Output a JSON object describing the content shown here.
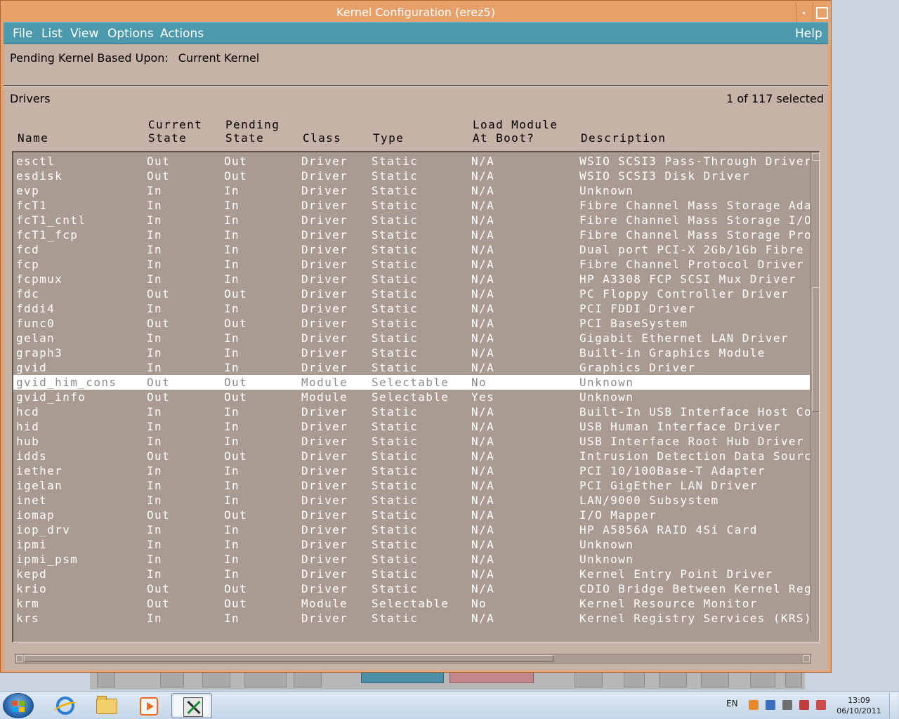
{
  "window": {
    "title": "Kernel Configuration (erez5)"
  },
  "menu": {
    "file": "File",
    "list": "List",
    "view": "View",
    "options": "Options",
    "actions": "Actions",
    "help": "Help"
  },
  "pending": {
    "label": "Pending Kernel Based Upon:",
    "value": "Current Kernel"
  },
  "list": {
    "title": "Drivers",
    "selection": "1 of 117 selected"
  },
  "columns": {
    "name": "Name",
    "current": "Current\nState",
    "pending": "Pending\nState",
    "class": "Class",
    "type": "Type",
    "load": "Load Module\nAt Boot?",
    "description": "Description"
  },
  "rows": [
    [
      "esctl",
      "Out",
      "Out",
      "Driver",
      "Static",
      "N/A",
      "WSIO SCSI3 Pass-Through Driver"
    ],
    [
      "esdisk",
      "Out",
      "Out",
      "Driver",
      "Static",
      "N/A",
      "WSIO SCSI3 Disk Driver"
    ],
    [
      "evp",
      "In",
      "In",
      "Driver",
      "Static",
      "N/A",
      "Unknown"
    ],
    [
      "fcT1",
      "In",
      "In",
      "Driver",
      "Static",
      "N/A",
      "Fibre Channel Mass Storage Ada"
    ],
    [
      "fcT1_cntl",
      "In",
      "In",
      "Driver",
      "Static",
      "N/A",
      "Fibre Channel Mass Storage I/O"
    ],
    [
      "fcT1_fcp",
      "In",
      "In",
      "Driver",
      "Static",
      "N/A",
      "Fibre Channel Mass Storage Pro"
    ],
    [
      "fcd",
      "In",
      "In",
      "Driver",
      "Static",
      "N/A",
      "Dual port PCI-X 2Gb/1Gb Fibre"
    ],
    [
      "fcp",
      "In",
      "In",
      "Driver",
      "Static",
      "N/A",
      "Fibre Channel Protocol Driver"
    ],
    [
      "fcpmux",
      "In",
      "In",
      "Driver",
      "Static",
      "N/A",
      "HP A3308 FCP SCSI Mux Driver"
    ],
    [
      "fdc",
      "Out",
      "Out",
      "Driver",
      "Static",
      "N/A",
      "PC Floppy Controller Driver"
    ],
    [
      "fddi4",
      "In",
      "In",
      "Driver",
      "Static",
      "N/A",
      "PCI FDDI Driver"
    ],
    [
      "func0",
      "Out",
      "Out",
      "Driver",
      "Static",
      "N/A",
      "PCI BaseSystem"
    ],
    [
      "gelan",
      "In",
      "In",
      "Driver",
      "Static",
      "N/A",
      "Gigabit Ethernet LAN Driver"
    ],
    [
      "graph3",
      "In",
      "In",
      "Driver",
      "Static",
      "N/A",
      "Built-in Graphics Module"
    ],
    [
      "gvid",
      "In",
      "In",
      "Driver",
      "Static",
      "N/A",
      "Graphics Driver"
    ],
    [
      "gvid_him_cons",
      "Out",
      "Out",
      "Module",
      "Selectable",
      "No",
      "Unknown"
    ],
    [
      "gvid_info",
      "Out",
      "Out",
      "Module",
      "Selectable",
      "Yes",
      "Unknown"
    ],
    [
      "hcd",
      "In",
      "In",
      "Driver",
      "Static",
      "N/A",
      "Built-In USB Interface Host Co"
    ],
    [
      "hid",
      "In",
      "In",
      "Driver",
      "Static",
      "N/A",
      "USB Human Interface Driver"
    ],
    [
      "hub",
      "In",
      "In",
      "Driver",
      "Static",
      "N/A",
      "USB Interface Root Hub Driver"
    ],
    [
      "idds",
      "Out",
      "Out",
      "Driver",
      "Static",
      "N/A",
      "Intrusion Detection Data Sourc"
    ],
    [
      "iether",
      "In",
      "In",
      "Driver",
      "Static",
      "N/A",
      "PCI 10/100Base-T Adapter"
    ],
    [
      "igelan",
      "In",
      "In",
      "Driver",
      "Static",
      "N/A",
      "PCI GigEther LAN Driver"
    ],
    [
      "inet",
      "In",
      "In",
      "Driver",
      "Static",
      "N/A",
      "LAN/9000 Subsystem"
    ],
    [
      "iomap",
      "Out",
      "Out",
      "Driver",
      "Static",
      "N/A",
      "I/O Mapper"
    ],
    [
      "iop_drv",
      "In",
      "In",
      "Driver",
      "Static",
      "N/A",
      "HP A5856A RAID 4Si Card"
    ],
    [
      "ipmi",
      "In",
      "In",
      "Driver",
      "Static",
      "N/A",
      "Unknown"
    ],
    [
      "ipmi_psm",
      "In",
      "In",
      "Driver",
      "Static",
      "N/A",
      "Unknown"
    ],
    [
      "kepd",
      "In",
      "In",
      "Driver",
      "Static",
      "N/A",
      "Kernel Entry Point Driver"
    ],
    [
      "krio",
      "Out",
      "Out",
      "Driver",
      "Static",
      "N/A",
      "CDIO Bridge Between Kernel Reg"
    ],
    [
      "krm",
      "Out",
      "Out",
      "Module",
      "Selectable",
      "No",
      "Kernel Resource Monitor"
    ],
    [
      "krs",
      "In",
      "In",
      "Driver",
      "Static",
      "N/A",
      "Kernel Registry Services (KRS)"
    ]
  ],
  "selected_row": "gvid_him_cons",
  "taskbar": {
    "apps": [
      "internet-explorer-icon",
      "folder-icon",
      "media-player-icon",
      "x-server-icon"
    ],
    "language": "EN",
    "time": "13:09",
    "date": "06/10/2011"
  },
  "colors": {
    "titlebar": "#e7a06a",
    "menubar": "#4c9aab",
    "list_bg": "#a99a92",
    "window_bg": "#c6b2a6"
  }
}
